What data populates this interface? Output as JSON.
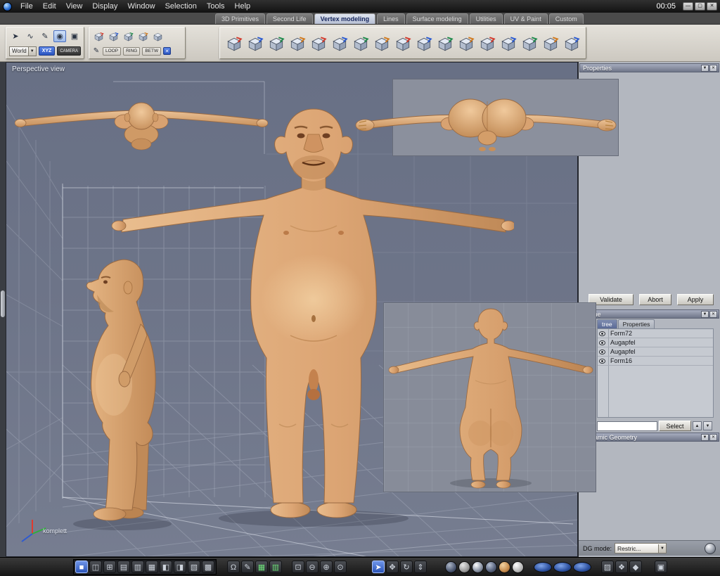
{
  "titlebar": {
    "clock": "00:05",
    "menus": [
      "File",
      "Edit",
      "View",
      "Display",
      "Window",
      "Selection",
      "Tools",
      "Help"
    ],
    "window_buttons": [
      {
        "name": "minimize-button",
        "glyph": "—"
      },
      {
        "name": "maximize-button",
        "glyph": "▢"
      },
      {
        "name": "close-button",
        "glyph": "✕"
      }
    ]
  },
  "tabs": [
    {
      "label": "3D Primitives",
      "active": false
    },
    {
      "label": "Second Life",
      "active": false
    },
    {
      "label": "Vertex modeling",
      "active": true
    },
    {
      "label": "Lines",
      "active": false
    },
    {
      "label": "Surface modeling",
      "active": false
    },
    {
      "label": "Utilities",
      "active": false
    },
    {
      "label": "UV & Paint",
      "active": false
    },
    {
      "label": "Custom",
      "active": false
    }
  ],
  "toolbar": {
    "world_value": "World",
    "xyz_button": "XYZ",
    "camera_button": "CAMERA",
    "loop_button": "LOOP",
    "ring_button": "RING",
    "betw_button": "BETW",
    "selection_tools": [
      {
        "name": "select-cursor-icon",
        "glyph": "➤"
      },
      {
        "name": "select-freehand-icon",
        "glyph": "∿"
      },
      {
        "name": "select-paint-icon",
        "glyph": "✎"
      },
      {
        "name": "select-sphere-icon",
        "glyph": "◉",
        "active": true
      },
      {
        "name": "select-camera-icon",
        "glyph": "▣"
      }
    ],
    "component_modes": [
      {
        "name": "mode-points-icon",
        "accent": "#d23b2e"
      },
      {
        "name": "mode-edges-icon",
        "accent": "#2a5ad0"
      },
      {
        "name": "mode-faces-icon",
        "accent": "#1f8a4c"
      },
      {
        "name": "mode-object-icon",
        "accent": "#d07a1f"
      },
      {
        "name": "mode-auto-icon",
        "accent": ""
      }
    ],
    "modeling_tools": [
      {
        "name": "vm-tool-1-icon",
        "accent": "#d23b2e"
      },
      {
        "name": "vm-tool-2-icon",
        "accent": "#2a5ad0"
      },
      {
        "name": "vm-tool-3-icon",
        "accent": "#1f8a4c"
      },
      {
        "name": "vm-tool-4-icon",
        "accent": "#d07a1f"
      },
      {
        "name": "vm-tool-5-icon",
        "accent": "#d23b2e"
      },
      {
        "name": "vm-tool-6-icon",
        "accent": "#2a5ad0"
      },
      {
        "name": "vm-tool-7-icon",
        "accent": "#1f8a4c"
      },
      {
        "name": "vm-tool-8-icon",
        "accent": "#d07a1f"
      },
      {
        "name": "vm-tool-9-icon",
        "accent": "#d23b2e"
      },
      {
        "name": "vm-tool-10-icon",
        "accent": "#2a5ad0"
      },
      {
        "name": "vm-tool-11-icon",
        "accent": "#1f8a4c"
      },
      {
        "name": "vm-tool-12-icon",
        "accent": "#d07a1f"
      },
      {
        "name": "vm-tool-13-icon",
        "accent": "#d23b2e"
      },
      {
        "name": "vm-tool-14-icon",
        "accent": "#2a5ad0"
      },
      {
        "name": "vm-tool-15-icon",
        "accent": "#1f8a4c"
      },
      {
        "name": "vm-tool-16-icon",
        "accent": "#d07a1f"
      },
      {
        "name": "vm-tool-17-icon",
        "accent": "#2a5ad0"
      }
    ]
  },
  "viewport": {
    "label": "Perspective view",
    "axis_caption": "komplett"
  },
  "panels": {
    "properties": {
      "title": "Properties"
    },
    "actions": {
      "validate": "Validate",
      "abort": "Abort",
      "apply": "Apply"
    },
    "scene": {
      "title": "Scene",
      "tabs": [
        {
          "label": "tree",
          "active": true
        },
        {
          "label": "Properties",
          "active": false
        }
      ],
      "items": [
        {
          "name": "Form72"
        },
        {
          "name": "Augapfel"
        },
        {
          "name": "Augapfel"
        },
        {
          "name": "Form16"
        }
      ],
      "filter_value": "",
      "select_button": "Select",
      "list_buttons": [
        {
          "name": "scene-up-button",
          "glyph": "▲"
        },
        {
          "name": "scene-down-button",
          "glyph": "▼"
        }
      ]
    },
    "dynamic_geometry": {
      "title": "Dynamic Geometry",
      "dg_mode_label": "DG mode:",
      "dg_mode_value": "Restric..."
    }
  },
  "bottombar": {
    "groups": [
      {
        "name": "viewport-layouts",
        "ml": 104,
        "boxed": true,
        "icons": [
          {
            "name": "layout-single-icon",
            "glyph": "■",
            "variant": "active"
          },
          {
            "name": "layout-two-vertical-icon",
            "glyph": "◫"
          },
          {
            "name": "layout-quad-icon",
            "glyph": "⊞"
          },
          {
            "name": "layout-rows-icon",
            "glyph": "▤"
          },
          {
            "name": "layout-columns-icon",
            "glyph": "▥"
          },
          {
            "name": "layout-grid-icon",
            "glyph": "▦"
          },
          {
            "name": "layout-left-split-icon",
            "glyph": "◧"
          },
          {
            "name": "layout-right-split-icon",
            "glyph": "◨"
          },
          {
            "name": "layout-three-icon",
            "glyph": "▧"
          },
          {
            "name": "layout-full-icon",
            "glyph": "▩"
          }
        ]
      },
      {
        "name": "snapping",
        "ml": 14,
        "icons": [
          {
            "name": "magnet-icon",
            "glyph": "Ω"
          },
          {
            "name": "pen-snap-icon",
            "glyph": "✎"
          },
          {
            "name": "table-green-icon",
            "glyph": "▦",
            "variant": "green"
          },
          {
            "name": "table-green-2-icon",
            "glyph": "▥",
            "variant": "green"
          }
        ]
      },
      {
        "name": "zoom-tools",
        "ml": 12,
        "icons": [
          {
            "name": "frame-region-icon",
            "glyph": "⊡"
          },
          {
            "name": "zoom-out-icon",
            "glyph": "⊖"
          },
          {
            "name": "zoom-in-icon",
            "glyph": "⊕"
          },
          {
            "name": "zoom-fit-icon",
            "glyph": "⊙"
          }
        ]
      },
      {
        "name": "navigation",
        "ml": 34,
        "icons": [
          {
            "name": "select-arrow-icon",
            "glyph": "➤",
            "variant": "active"
          },
          {
            "name": "pan-icon",
            "glyph": "✥"
          },
          {
            "name": "orbit-icon",
            "glyph": "↻"
          },
          {
            "name": "dolly-icon",
            "glyph": "⇕"
          }
        ]
      },
      {
        "name": "shading-modes",
        "ml": 24,
        "icons": [
          {
            "name": "wireframe-sphere-icon",
            "variant": "sphere-wire"
          },
          {
            "name": "hidden-line-sphere-icon",
            "variant": "sphere-flat"
          },
          {
            "name": "smooth-sphere-icon",
            "variant": "sphere-smooth"
          },
          {
            "name": "shaded-sphere-icon",
            "variant": "sphere-dark"
          },
          {
            "name": "textured-sphere-icon",
            "variant": "sphere-tan"
          },
          {
            "name": "point-light-icon",
            "variant": "sphere-small"
          }
        ]
      },
      {
        "name": "visibility",
        "ml": 12,
        "icons": [
          {
            "name": "show-all-oval-icon",
            "variant": "oval"
          },
          {
            "name": "hide-other-oval-icon",
            "variant": "oval"
          },
          {
            "name": "ghost-oval-icon",
            "variant": "oval"
          }
        ]
      },
      {
        "name": "painting",
        "ml": 12,
        "icons": [
          {
            "name": "material-icon",
            "glyph": "▨"
          },
          {
            "name": "uv-tools-icon",
            "glyph": "❖"
          },
          {
            "name": "texture-icon",
            "glyph": "◆"
          }
        ]
      },
      {
        "name": "render",
        "ml": 16,
        "icons": [
          {
            "name": "render-camera-icon",
            "glyph": "▣"
          }
        ]
      }
    ]
  }
}
